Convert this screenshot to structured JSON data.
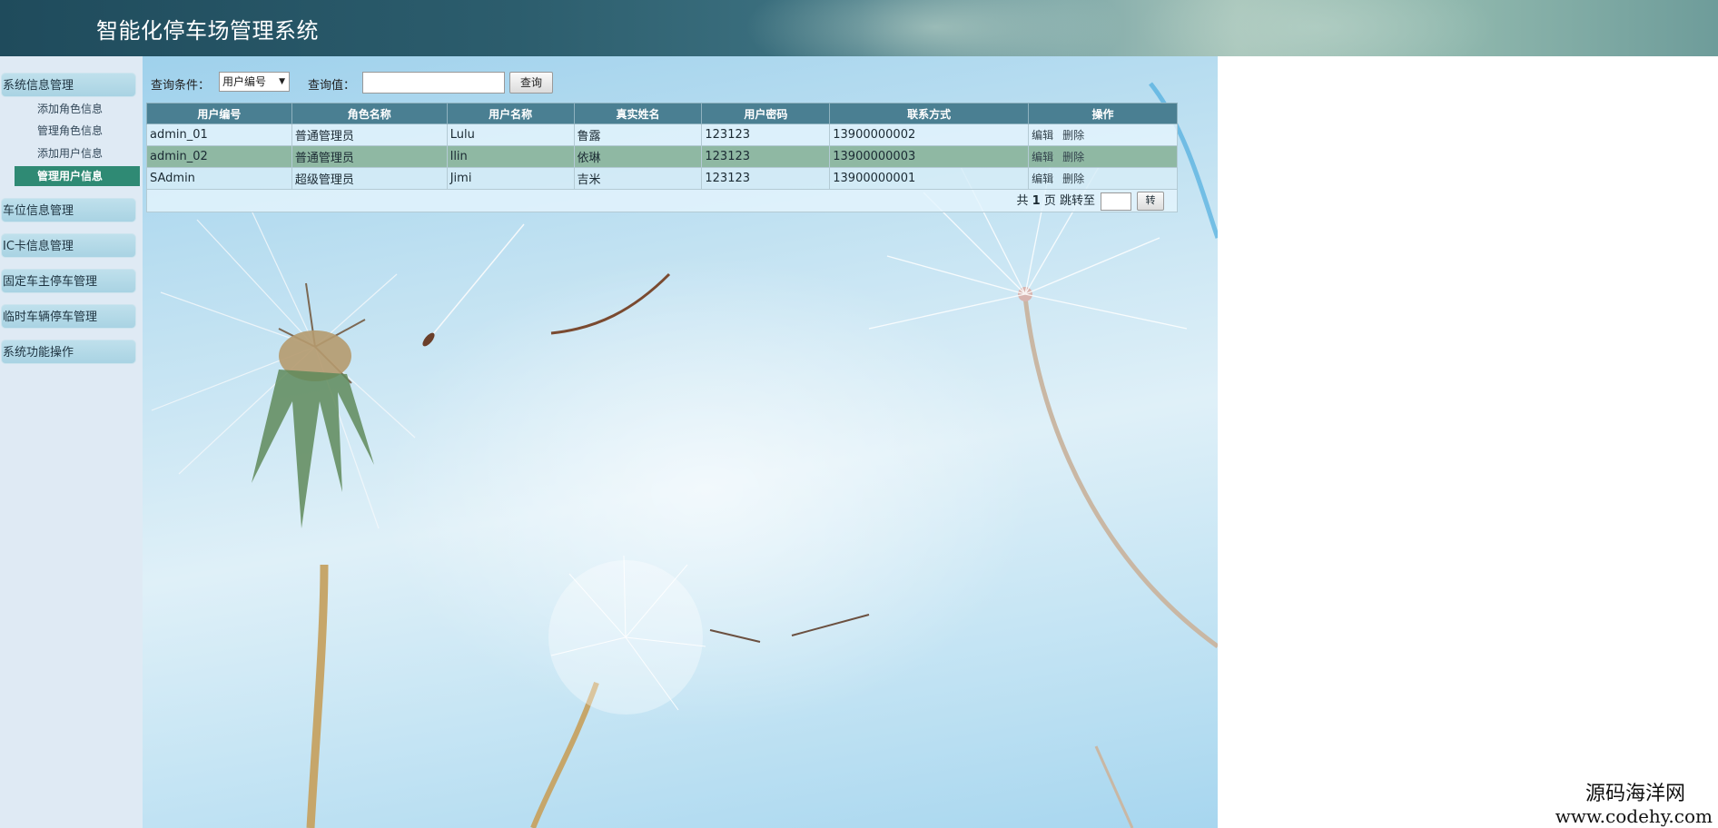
{
  "app": {
    "title": "智能化停车场管理系统"
  },
  "sidebar": {
    "groups": [
      {
        "label": "系统信息管理"
      },
      {
        "label": "车位信息管理"
      },
      {
        "label": "IC卡信息管理"
      },
      {
        "label": "固定车主停车管理"
      },
      {
        "label": "临时车辆停车管理"
      },
      {
        "label": "系统功能操作"
      }
    ],
    "subitems": [
      {
        "label": "添加角色信息"
      },
      {
        "label": "管理角色信息"
      },
      {
        "label": "添加用户信息"
      },
      {
        "label": "管理用户信息"
      }
    ]
  },
  "query": {
    "condition_label": "查询条件：",
    "condition_selected": "用户编号",
    "value_label": "查询值：",
    "value_text": "",
    "search_button": "查询"
  },
  "table": {
    "headers": [
      "用户编号",
      "角色名称",
      "用户名称",
      "真实姓名",
      "用户密码",
      "联系方式",
      "操作"
    ],
    "rows": [
      {
        "user_id": "admin_01",
        "role": "普通管理员",
        "username": "Lulu",
        "real_name": "鲁露",
        "password": "123123",
        "contact": "13900000002",
        "edit": "编辑",
        "delete": "删除"
      },
      {
        "user_id": "admin_02",
        "role": "普通管理员",
        "username": "llin",
        "real_name": "依琳",
        "password": "123123",
        "contact": "13900000003",
        "edit": "编辑",
        "delete": "删除"
      },
      {
        "user_id": "SAdmin",
        "role": "超级管理员",
        "username": "Jimi",
        "real_name": "吉米",
        "password": "123123",
        "contact": "13900000001",
        "edit": "编辑",
        "delete": "删除"
      }
    ]
  },
  "pager": {
    "prefix": "共",
    "total_pages": "1",
    "suffix": "页 跳转至",
    "go_button": "转"
  },
  "watermark": {
    "line1": "源码海洋网",
    "line2": "www.codehy.com"
  },
  "colors": {
    "header": "#2c5d6d",
    "table_header": "#4a7f92",
    "active_item": "#2f8a74",
    "selected_row": "#8fb8a3"
  }
}
